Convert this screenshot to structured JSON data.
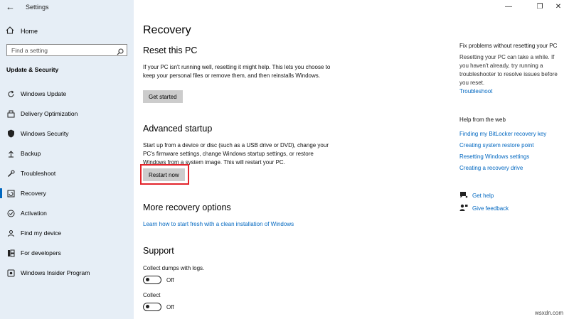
{
  "window": {
    "title": "Settings",
    "minimize_glyph": "—",
    "restore_glyph": "❐",
    "close_glyph": "✕"
  },
  "sidebar": {
    "home_label": "Home",
    "search_placeholder": "Find a setting",
    "section_title": "Update & Security",
    "items": [
      {
        "label": "Windows Update",
        "icon": "refresh-icon"
      },
      {
        "label": "Delivery Optimization",
        "icon": "delivery-icon"
      },
      {
        "label": "Windows Security",
        "icon": "shield-icon"
      },
      {
        "label": "Backup",
        "icon": "backup-icon"
      },
      {
        "label": "Troubleshoot",
        "icon": "wrench-icon"
      },
      {
        "label": "Recovery",
        "icon": "recovery-icon",
        "active": true
      },
      {
        "label": "Activation",
        "icon": "activation-icon"
      },
      {
        "label": "Find my device",
        "icon": "person-pin-icon"
      },
      {
        "label": "For developers",
        "icon": "developer-icon"
      },
      {
        "label": "Windows Insider Program",
        "icon": "insider-icon"
      }
    ]
  },
  "main": {
    "title": "Recovery",
    "reset": {
      "heading": "Reset this PC",
      "description": "If your PC isn't running well, resetting it might help. This lets you choose to keep your personal files or remove them, and then reinstalls Windows.",
      "button": "Get started"
    },
    "advanced": {
      "heading": "Advanced startup",
      "description": "Start up from a device or disc (such as a USB drive or DVD), change your PC's firmware settings, change Windows startup settings, or restore Windows from a system image. This will restart your PC.",
      "button": "Restart now"
    },
    "more": {
      "heading": "More recovery options",
      "link": "Learn how to start fresh with a clean installation of Windows"
    },
    "support": {
      "heading": "Support",
      "dumps_label": "Collect dumps with logs.",
      "dumps_state": "Off",
      "collect_label": "Collect",
      "collect_state": "Off"
    }
  },
  "right": {
    "fix_heading": "Fix problems without resetting your PC",
    "fix_text": "Resetting your PC can take a while. If you haven't already, try running a troubleshooter to resolve issues before you reset.",
    "troubleshoot_link": "Troubleshoot",
    "web_heading": "Help from the web",
    "web_links": [
      "Finding my BitLocker recovery key",
      "Creating system restore point",
      "Resetting Windows settings",
      "Creating a recovery drive"
    ],
    "get_help": "Get help",
    "give_feedback": "Give feedback"
  },
  "watermark": "wsxdn.com",
  "colors": {
    "accent": "#0067c0",
    "sidebar_bg": "#e6eef6",
    "highlight": "#e3242b"
  }
}
